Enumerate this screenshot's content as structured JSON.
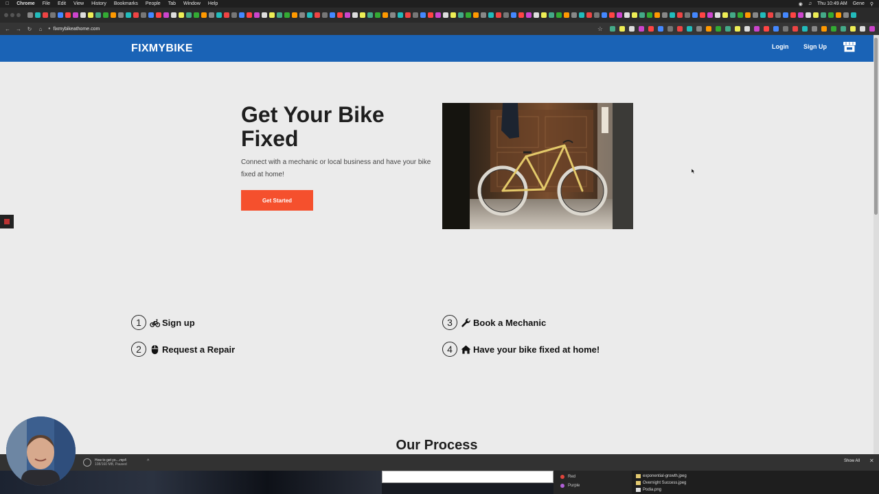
{
  "mac_menubar": {
    "app": "Chrome",
    "menus": [
      "File",
      "Edit",
      "View",
      "History",
      "Bookmarks",
      "People",
      "Tab",
      "Window",
      "Help"
    ],
    "clock": "Thu 10:49 AM",
    "user": "Gene"
  },
  "browser": {
    "url": "fixmybikeathome.com"
  },
  "site": {
    "brand": "FIXMYBIKE",
    "nav": {
      "login": "Login",
      "signup": "Sign Up"
    },
    "brand_color": "#1a63b6",
    "accent_color": "#f5502d"
  },
  "hero": {
    "title": "Get Your Bike Fixed",
    "subtitle": "Connect with a mechanic or local business and have your bike fixed at home!",
    "cta": "Get Started"
  },
  "steps": [
    {
      "number": "1",
      "icon": "bicycle-icon",
      "label": "Sign up"
    },
    {
      "number": "2",
      "icon": "mouse-icon",
      "label": "Request a Repair"
    },
    {
      "number": "3",
      "icon": "wrench-icon",
      "label": "Book a Mechanic"
    },
    {
      "number": "4",
      "icon": "home-icon",
      "label": "Have your bike fixed at home!"
    }
  ],
  "process": {
    "title": "Our Process"
  },
  "downloads": {
    "filename": "How to get yo....mp4",
    "status": "108/160 MB, Paused",
    "show_all": "Show All"
  },
  "desktop": {
    "tags": [
      {
        "label": "Red",
        "color": "#e0443c"
      },
      {
        "label": "Purple",
        "color": "#b05fd6"
      }
    ],
    "files": [
      "exponential-growth.jpeg",
      "Overnight Success.jpeg",
      "Podia.png"
    ]
  }
}
